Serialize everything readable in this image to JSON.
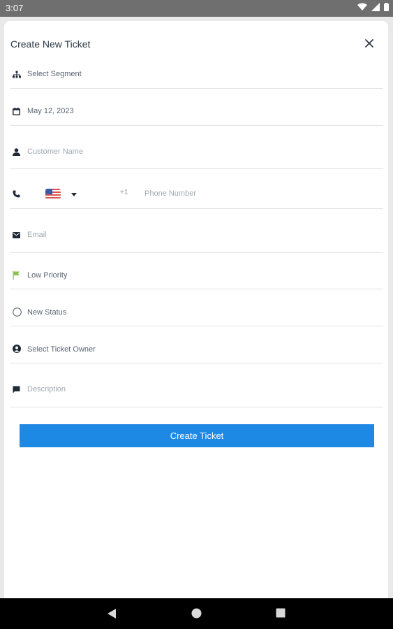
{
  "status_bar": {
    "time": "3:07"
  },
  "dialog": {
    "title": "Create New Ticket",
    "fields": {
      "segment": "Select Segment",
      "date": "May 12, 2023",
      "customer_name_placeholder": "Customer Name",
      "country_code": "+1",
      "phone_placeholder": "Phone Number",
      "email_placeholder": "Email",
      "priority": "Low Priority",
      "status": "New Status",
      "ticket_owner": "Select Ticket Owner",
      "description_placeholder": "Description"
    },
    "submit_label": "Create Ticket"
  },
  "colors": {
    "primary": "#1e88e5",
    "priority_flag": "#8bc34a",
    "icon": "#1f2a38"
  },
  "icons": [
    "segment-icon",
    "calendar-icon",
    "person-icon",
    "phone-icon",
    "us-flag-icon",
    "email-icon",
    "flag-icon",
    "circle-status-icon",
    "owner-icon",
    "description-icon",
    "close-icon"
  ]
}
